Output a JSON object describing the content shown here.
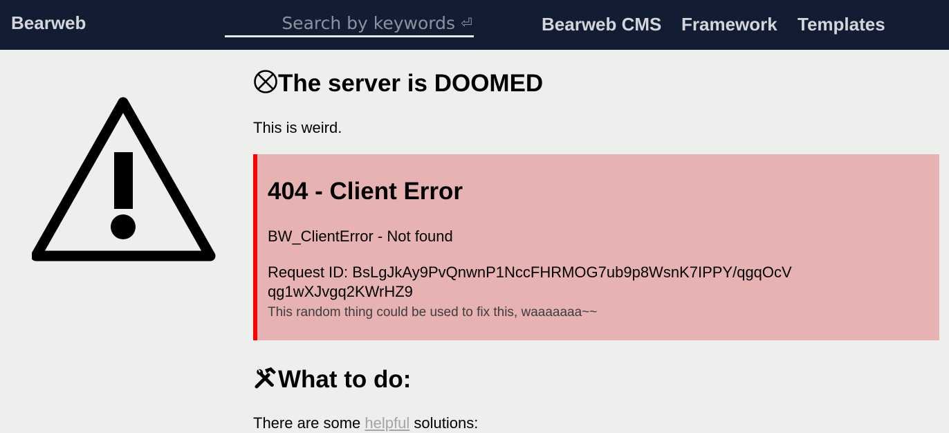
{
  "header": {
    "brand": "Bearweb",
    "search": {
      "placeholder": "Search by keywords",
      "value": "",
      "enter_glyph": "⏎"
    },
    "nav": [
      {
        "label": "Bearweb CMS"
      },
      {
        "label": "Framework"
      },
      {
        "label": "Templates"
      }
    ]
  },
  "main": {
    "title_icon": "circle-x-icon",
    "title": "The server is DOOMED",
    "intro": "This is weird.",
    "error": {
      "title": "404 - Client Error",
      "type": "BW_ClientError - Not found",
      "request_id_label": "Request ID: ",
      "request_id": "BsLgJkAy9PvQnwnP1NccFHRMOG7ub9p8WsnK7IPPY/qgqOcVqg1wXJvgq2KWrHZ9",
      "note": "This random thing could be used to fix this, waaaaaaa~~"
    },
    "todo_icon": "hammer-wrench-icon",
    "todo_title": "What to do:",
    "solutions": {
      "before": "There are some ",
      "link": "helpful",
      "after": " solutions:"
    }
  },
  "colors": {
    "header_bg": "#121c33",
    "page_bg": "#edefec",
    "error_bg": "#e6b2b2",
    "error_accent": "#ff0000"
  },
  "side_graphic": "warning-triangle-icon"
}
